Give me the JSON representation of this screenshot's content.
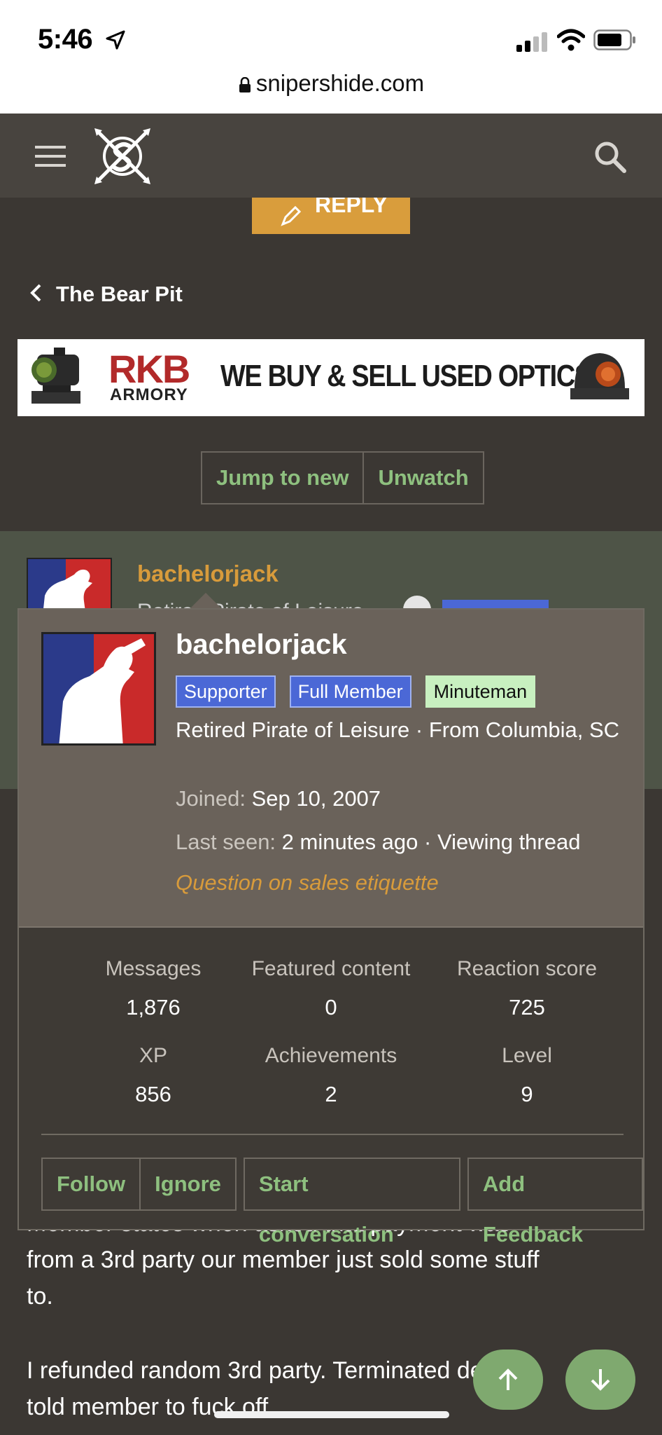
{
  "status_bar": {
    "time": "5:46"
  },
  "browser": {
    "url": "snipershide.com"
  },
  "nav": {
    "menu_icon": "hamburger-icon",
    "logo_icon": "snipershide-logo",
    "search_icon": "search-icon"
  },
  "reply_button": {
    "label": "REPLY"
  },
  "breadcrumb": {
    "label": "The Bear Pit"
  },
  "ad_banner": {
    "brand_line1": "RKB",
    "brand_line2": "ARMORY",
    "tagline": "WE BUY & SELL USED OPTICS"
  },
  "thread_buttons": {
    "jump": "Jump to new",
    "unwatch": "Unwatch"
  },
  "post": {
    "username": "bachelorjack",
    "subtitle_fragment": "Retired Pirate of Leisure"
  },
  "popup": {
    "username": "bachelorjack",
    "badges": [
      "Supporter",
      "Full Member",
      "Minuteman"
    ],
    "user_title": "Retired Pirate of Leisure · From Columbia, SC",
    "joined_label": "Joined:",
    "joined_value": "Sep 10, 2007",
    "last_seen_label": "Last seen:",
    "last_seen_value": "2 minutes ago · Viewing thread",
    "thread_link": "Question on sales etiquette",
    "stats": [
      {
        "label": "Messages",
        "value": "1,876"
      },
      {
        "label": "Featured content",
        "value": "0"
      },
      {
        "label": "Reaction score",
        "value": "725"
      },
      {
        "label": "XP",
        "value": "856"
      },
      {
        "label": "Achievements",
        "value": "2"
      },
      {
        "label": "Level",
        "value": "9"
      }
    ],
    "actions": {
      "follow": "Follow",
      "ignore": "Ignore",
      "start_conversation": "Start conversation",
      "add_feedback": "Add Feedback"
    }
  },
  "body_text": {
    "line1_partial": "Member states when asked that payment was",
    "line2": "from a 3rd party our member just sold some stuff",
    "line3": "to.",
    "line4": "I refunded random 3rd party. Terminated deal,",
    "line5": "told member to fuck off."
  },
  "scroll_buttons": {
    "up_icon": "arrow-up-icon",
    "down_icon": "arrow-down-icon"
  },
  "colors": {
    "accent_green": "#8ec07f",
    "accent_orange": "#d89b3b",
    "badge_blue": "#4b68d6"
  }
}
